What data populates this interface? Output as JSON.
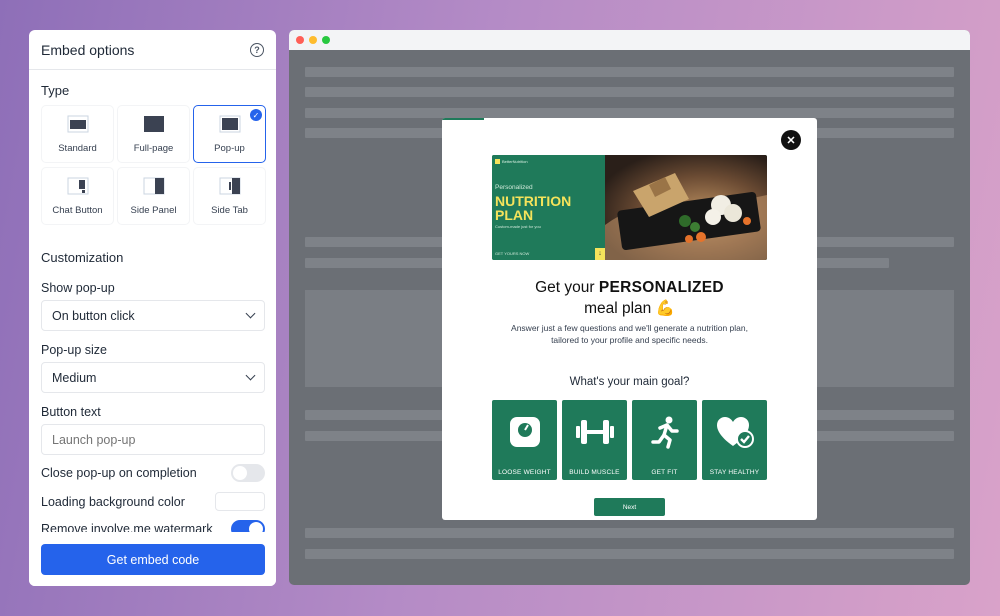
{
  "panel": {
    "title": "Embed options",
    "help_icon": "?",
    "type_heading": "Type",
    "types": [
      {
        "label": "Standard",
        "selected": false
      },
      {
        "label": "Full-page",
        "selected": false
      },
      {
        "label": "Pop-up",
        "selected": true
      },
      {
        "label": "Chat Button",
        "selected": false
      },
      {
        "label": "Side Panel",
        "selected": false
      },
      {
        "label": "Side Tab",
        "selected": false
      }
    ],
    "customization_heading": "Customization",
    "show_popup": {
      "label": "Show pop-up",
      "value": "On button click"
    },
    "popup_size": {
      "label": "Pop-up size",
      "value": "Medium"
    },
    "button_text": {
      "label": "Button text",
      "placeholder": "Launch pop-up"
    },
    "close_on_completion": {
      "label": "Close pop-up on completion",
      "on": false
    },
    "loading_bg": {
      "label": "Loading background color"
    },
    "remove_watermark": {
      "label": "Remove involve.me watermark",
      "on": true
    },
    "embed_button": "Get embed code"
  },
  "browser": {
    "dots": [
      "#ff5f57",
      "#febc2e",
      "#28c840"
    ]
  },
  "popup": {
    "close_icon": "✕",
    "hero": {
      "brand": "BetterNutrition",
      "sub": "Personalized",
      "title": "NUTRITION PLAN",
      "tag": "Custom-made just for you",
      "cta": "GET YOURS NOW",
      "arrow": "↓"
    },
    "headline_pre": "Get your ",
    "headline_bold": "PERSONALIZED",
    "headline_post": "meal plan 💪",
    "description": "Answer just a few questions and we'll generate a nutrition plan, tailored to your profile and specific needs.",
    "question": "What's your main goal?",
    "goals": [
      {
        "label": "LOOSE WEIGHT",
        "icon": "scale-icon"
      },
      {
        "label": "BUILD MUSCLE",
        "icon": "dumbbell-icon"
      },
      {
        "label": "GET FIT",
        "icon": "running-icon"
      },
      {
        "label": "STAY HEALTHY",
        "icon": "heart-check-icon"
      }
    ],
    "next_button": "Next"
  },
  "colors": {
    "accent": "#2563eb",
    "brand_green": "#1f7a5a",
    "brand_yellow": "#f5e35b"
  }
}
